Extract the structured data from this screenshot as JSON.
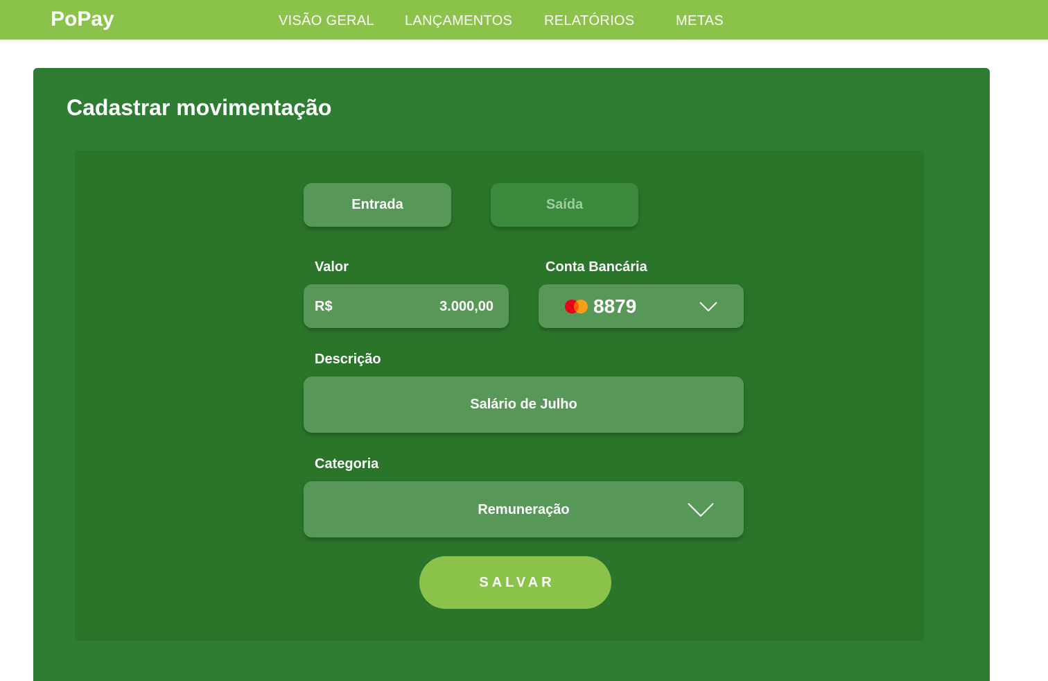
{
  "app": {
    "name": "PoPay"
  },
  "nav": {
    "items": [
      {
        "label": "VISÃO GERAL"
      },
      {
        "label": "LANÇAMENTOS"
      },
      {
        "label": "RELATÓRIOS"
      },
      {
        "label": "METAS"
      }
    ]
  },
  "form": {
    "title": "Cadastrar movimentação",
    "type_toggle": {
      "entrada_label": "Entrada",
      "saida_label": "Saída",
      "selected": "Entrada"
    },
    "valor": {
      "label": "Valor",
      "currency": "R$",
      "value": "3.000,00"
    },
    "conta": {
      "label": "Conta Bancária",
      "card_brand_icon": "mastercard-icon",
      "value": "8879"
    },
    "descricao": {
      "label": "Descrição",
      "value": "Salário de Julho"
    },
    "categoria": {
      "label": "Categoria",
      "value": "Remuneração"
    },
    "save_label": "SALVAR"
  },
  "colors": {
    "topbar": "#8bc34a",
    "card": "#2e7d32",
    "panel": "#2b752b",
    "field": "#579858",
    "save_button": "#8bc34a",
    "mastercard_red": "#eb001b",
    "mastercard_orange": "#f79e1b"
  }
}
